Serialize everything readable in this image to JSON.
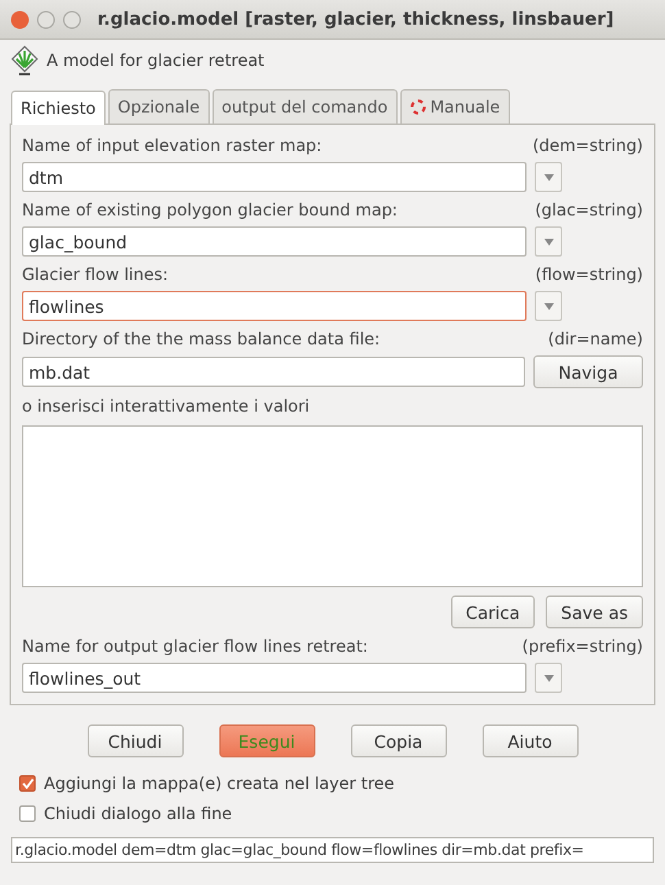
{
  "window": {
    "title": "r.glacio.model [raster, glacier, thickness, linsbauer]"
  },
  "description": "A model for glacier retreat",
  "tabs": [
    {
      "label": "Richiesto",
      "selected": true,
      "icon": false
    },
    {
      "label": "Opzionale",
      "selected": false,
      "icon": false
    },
    {
      "label": "output del comando",
      "selected": false,
      "icon": false
    },
    {
      "label": "Manuale",
      "selected": false,
      "icon": true
    }
  ],
  "params": [
    {
      "kind": "combo",
      "label": "Name of input elevation raster map:",
      "hint": "(dem=string)",
      "value": "dtm",
      "focused": false
    },
    {
      "kind": "combo",
      "label": "Name of existing polygon glacier bound map:",
      "hint": "(glac=string)",
      "value": "glac_bound",
      "focused": false
    },
    {
      "kind": "combo",
      "label": "Glacier flow lines:",
      "hint": "(flow=string)",
      "value": "flowlines",
      "focused": true
    },
    {
      "kind": "file",
      "label": "Directory of the the mass balance data file:",
      "hint": "(dir=name)",
      "value": "mb.dat",
      "button": "Naviga"
    },
    {
      "kind": "textarea",
      "label": "o inserisci interattivamente i valori",
      "buttons": [
        "Carica",
        "Save as"
      ]
    },
    {
      "kind": "combo",
      "label": "Name for output glacier flow lines retreat:",
      "hint": "(prefix=string)",
      "value": "flowlines_out",
      "focused": false
    }
  ],
  "buttons": [
    {
      "label": "Chiudi",
      "highlighted": false
    },
    {
      "label": "Esegui",
      "highlighted": true
    },
    {
      "label": "Copia",
      "highlighted": false
    },
    {
      "label": "Aiuto",
      "highlighted": false
    }
  ],
  "checkboxes": [
    {
      "label": "Aggiungi la mappa(e) creata nel layer tree",
      "checked": true
    },
    {
      "label": "Chiudi dialogo alla fine",
      "checked": false
    }
  ],
  "status_bar": "r.glacio.model dem=dtm glac=glac_bound flow=flowlines dir=mb.dat prefix="
}
